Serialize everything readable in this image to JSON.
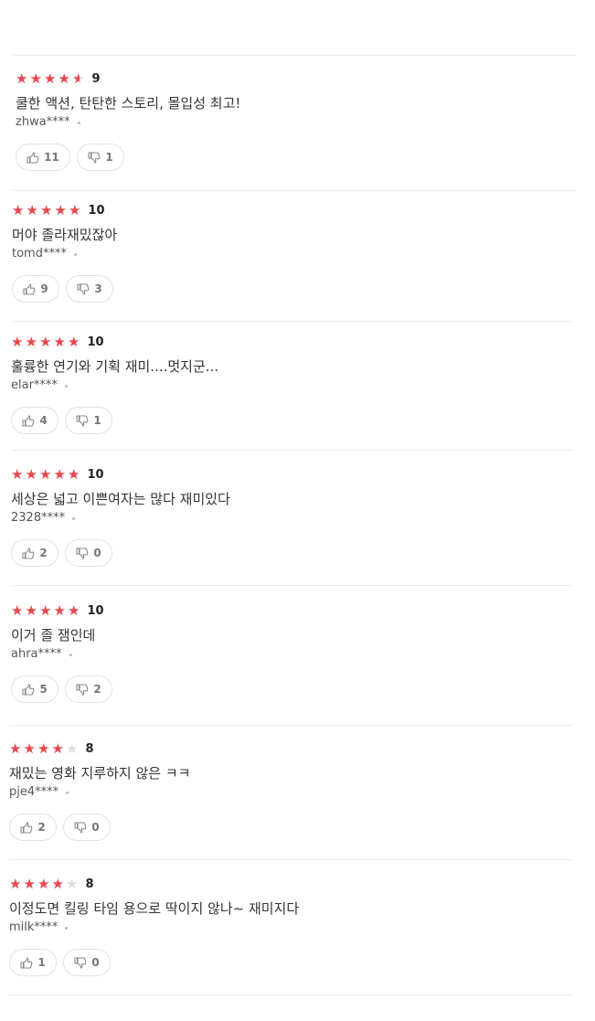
{
  "reviews": [
    {
      "rating": 4.5,
      "score": "9",
      "text": "쿨한 액션, 탄탄한 스토리, 몰입성 최고!",
      "author": "zhwa****",
      "likes": "11",
      "dislikes": "1"
    },
    {
      "rating": 5,
      "score": "10",
      "text": "머야 졸라재밌잖아",
      "author": "tomd****",
      "likes": "9",
      "dislikes": "3"
    },
    {
      "rating": 5,
      "score": "10",
      "text": "훌륭한 연기와 기획 재미....멋지군...",
      "author": "elar****",
      "likes": "4",
      "dislikes": "1"
    },
    {
      "rating": 5,
      "score": "10",
      "text": "세상은 넓고 이쁜여자는 많다 재미있다",
      "author": "2328****",
      "likes": "2",
      "dislikes": "0"
    },
    {
      "rating": 5,
      "score": "10",
      "text": "이거 졸 잼인데",
      "author": "ahra****",
      "likes": "5",
      "dislikes": "2"
    },
    {
      "rating": 4,
      "score": "8",
      "text": "재밌는 영화 지루하지 않은 ㅋㅋ",
      "author": "pje4****",
      "likes": "2",
      "dislikes": "0"
    },
    {
      "rating": 4,
      "score": "8",
      "text": "이정도면 킬링 타임 용으로 딱이지 않나~ 재미지다",
      "author": "milk****",
      "likes": "1",
      "dislikes": "0"
    }
  ],
  "colors": {
    "star_filled": "#e8474f",
    "star_empty": "#dddddd"
  },
  "icons": {
    "like": "thumbs-up-icon",
    "dislike": "thumbs-down-icon",
    "star": "star-icon"
  }
}
